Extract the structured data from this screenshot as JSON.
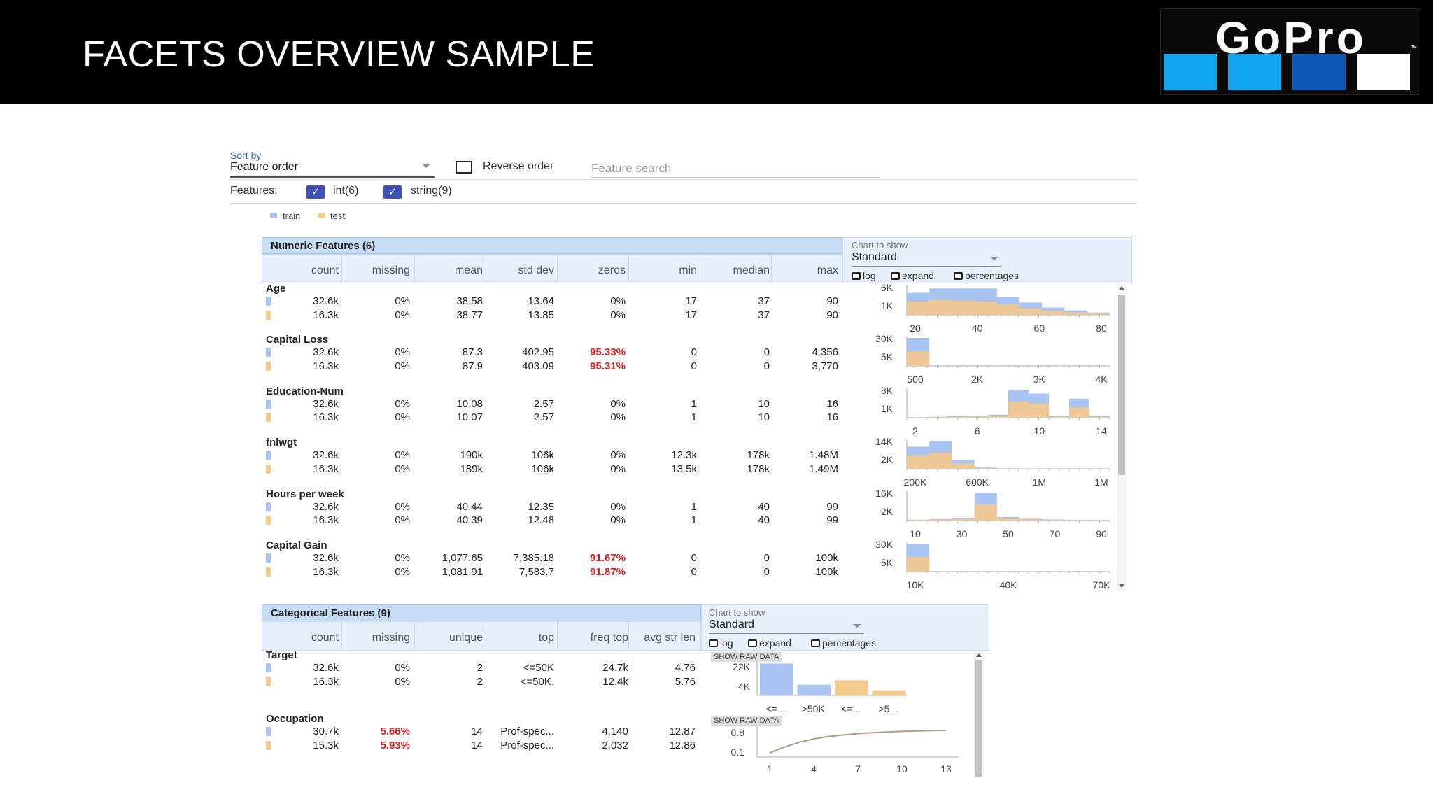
{
  "slide": {
    "title": "FACETS OVERVIEW SAMPLE"
  },
  "logo": {
    "text": "GoPro",
    "trademark": "™",
    "squares": [
      "#12a6ee",
      "#12a6ee",
      "#0c5ab6",
      "#ffffff"
    ]
  },
  "controls": {
    "sort_by_label": "Sort by",
    "sort_by_value": "Feature order",
    "reverse_order_label": "Reverse order",
    "feature_search_placeholder": "Feature search",
    "features_label": "Features:",
    "int_label": "int(6)",
    "string_label": "string(9)",
    "legend": [
      {
        "label": "train",
        "color": "#a9c4f3"
      },
      {
        "label": "test",
        "color": "#f4c98c"
      }
    ]
  },
  "chart_panel": {
    "label": "Chart to show",
    "value": "Standard",
    "log": "log",
    "expand": "expand",
    "percentages": "percentages",
    "show_raw_data": "SHOW RAW DATA"
  },
  "numeric": {
    "title": "Numeric Features (6)",
    "columns": [
      "count",
      "missing",
      "mean",
      "std dev",
      "zeros",
      "min",
      "median",
      "max"
    ],
    "features": [
      {
        "name": "Age",
        "rows": [
          [
            "32.6k",
            "0%",
            "38.58",
            "13.64",
            "0%",
            "17",
            "37",
            "90"
          ],
          [
            "16.3k",
            "0%",
            "38.77",
            "13.85",
            "0%",
            "17",
            "37",
            "90"
          ]
        ],
        "zeros_red": false,
        "chart": {
          "y_ticks": [
            "6K",
            "1K"
          ],
          "x_ticks": [
            "20",
            "40",
            "60",
            "80"
          ],
          "train": [
            0.75,
            0.9,
            0.9,
            0.9,
            0.62,
            0.42,
            0.25,
            0.15,
            0.08
          ],
          "test": [
            0.45,
            0.5,
            0.48,
            0.45,
            0.35,
            0.22,
            0.14,
            0.08,
            0.04
          ]
        }
      },
      {
        "name": "Capital Loss",
        "rows": [
          [
            "32.6k",
            "0%",
            "87.3",
            "402.95",
            "95.33%",
            "0",
            "0",
            "4,356"
          ],
          [
            "16.3k",
            "0%",
            "87.9",
            "403.09",
            "95.31%",
            "0",
            "0",
            "3,770"
          ]
        ],
        "zeros_red": true,
        "chart": {
          "y_ticks": [
            "30K",
            "5K"
          ],
          "x_ticks": [
            "500",
            "2K",
            "3K",
            "4K"
          ],
          "train": [
            0.95,
            0.0,
            0.0,
            0.0,
            0.0,
            0.0,
            0.0,
            0.0,
            0.0
          ],
          "test": [
            0.5,
            0.0,
            0.0,
            0.0,
            0.0,
            0.0,
            0.0,
            0.0,
            0.0
          ]
        }
      },
      {
        "name": "Education-Num",
        "rows": [
          [
            "32.6k",
            "0%",
            "10.08",
            "2.57",
            "0%",
            "1",
            "10",
            "16"
          ],
          [
            "16.3k",
            "0%",
            "10.07",
            "2.57",
            "0%",
            "1",
            "10",
            "16"
          ]
        ],
        "zeros_red": false,
        "chart": {
          "y_ticks": [
            "8K",
            "1K"
          ],
          "x_ticks": [
            "2",
            "6",
            "10",
            "14"
          ],
          "train": [
            0.02,
            0.03,
            0.05,
            0.06,
            0.1,
            0.95,
            0.82,
            0.05,
            0.65,
            0.05
          ],
          "test": [
            0.01,
            0.02,
            0.03,
            0.04,
            0.06,
            0.55,
            0.48,
            0.03,
            0.35,
            0.03
          ]
        }
      },
      {
        "name": "fnlwgt",
        "rows": [
          [
            "32.6k",
            "0%",
            "190k",
            "106k",
            "0%",
            "12.3k",
            "178k",
            "1.48M"
          ],
          [
            "16.3k",
            "0%",
            "189k",
            "106k",
            "0%",
            "13.5k",
            "178k",
            "1.49M"
          ]
        ],
        "zeros_red": false,
        "chart": {
          "y_ticks": [
            "14K",
            "2K"
          ],
          "x_ticks": [
            "200K",
            "600K",
            "1M",
            "1M"
          ],
          "train": [
            0.75,
            0.95,
            0.3,
            0.04,
            0.02,
            0.01,
            0.0,
            0.0,
            0.0
          ],
          "test": [
            0.45,
            0.55,
            0.18,
            0.02,
            0.01,
            0.0,
            0.0,
            0.0,
            0.0
          ]
        }
      },
      {
        "name": "Hours per week",
        "rows": [
          [
            "32.6k",
            "0%",
            "40.44",
            "12.35",
            "0%",
            "1",
            "40",
            "99"
          ],
          [
            "16.3k",
            "0%",
            "40.39",
            "12.48",
            "0%",
            "1",
            "40",
            "99"
          ]
        ],
        "zeros_red": false,
        "chart": {
          "y_ticks": [
            "16K",
            "2K"
          ],
          "x_ticks": [
            "10",
            "30",
            "50",
            "70",
            "90"
          ],
          "train": [
            0.03,
            0.05,
            0.08,
            0.95,
            0.12,
            0.06,
            0.04,
            0.02,
            0.02
          ],
          "test": [
            0.02,
            0.03,
            0.05,
            0.55,
            0.07,
            0.04,
            0.02,
            0.01,
            0.01
          ]
        }
      },
      {
        "name": "Capital Gain",
        "rows": [
          [
            "32.6k",
            "0%",
            "1,077.65",
            "7,385.18",
            "91.67%",
            "0",
            "0",
            "100k"
          ],
          [
            "16.3k",
            "0%",
            "1,081.91",
            "7,583.7",
            "91.87%",
            "0",
            "0",
            "100k"
          ]
        ],
        "zeros_red": true,
        "chart": {
          "y_ticks": [
            "30K",
            "5K"
          ],
          "x_ticks": [
            "10K",
            "40K",
            "70K"
          ],
          "train": [
            0.95,
            0.0,
            0.0,
            0.0,
            0.0,
            0.0,
            0.0,
            0.0,
            0.0
          ],
          "test": [
            0.5,
            0.0,
            0.0,
            0.0,
            0.0,
            0.0,
            0.0,
            0.0,
            0.0
          ]
        }
      }
    ]
  },
  "categorical": {
    "title": "Categorical Features (9)",
    "columns": [
      "count",
      "missing",
      "unique",
      "top",
      "freq top",
      "avg str len"
    ],
    "features": [
      {
        "name": "Target",
        "rows": [
          [
            "32.6k",
            "0%",
            "2",
            "<=50K",
            "24.7k",
            "4.76"
          ],
          [
            "16.3k",
            "0%",
            "2",
            "<=50K.",
            "12.4k",
            "5.76"
          ]
        ],
        "missing_red": false,
        "chart": {
          "kind": "bar",
          "y_ticks": [
            "22K",
            "4K"
          ],
          "x_ticks": [
            "<=...",
            ">50K",
            "<=...",
            ">5..."
          ],
          "bars": [
            {
              "series": "train",
              "value": 0.95
            },
            {
              "series": "train",
              "value": 0.32
            },
            {
              "series": "test",
              "value": 0.45
            },
            {
              "series": "test",
              "value": 0.15
            }
          ]
        }
      },
      {
        "name": "Occupation",
        "rows": [
          [
            "30.7k",
            "5.66%",
            "14",
            "Prof-spec...",
            "4,140",
            "12.87"
          ],
          [
            "15.3k",
            "5.93%",
            "14",
            "Prof-spec...",
            "2,032",
            "12.86"
          ]
        ],
        "missing_red": true,
        "chart": {
          "kind": "cdf",
          "y_ticks": [
            "0.8",
            "0.1"
          ],
          "x_ticks": [
            "1",
            "4",
            "7",
            "10",
            "13"
          ],
          "curve": [
            0.1,
            0.32,
            0.5,
            0.63,
            0.72,
            0.78,
            0.83,
            0.86,
            0.89,
            0.91,
            0.93,
            0.94,
            0.95
          ]
        }
      }
    ]
  }
}
